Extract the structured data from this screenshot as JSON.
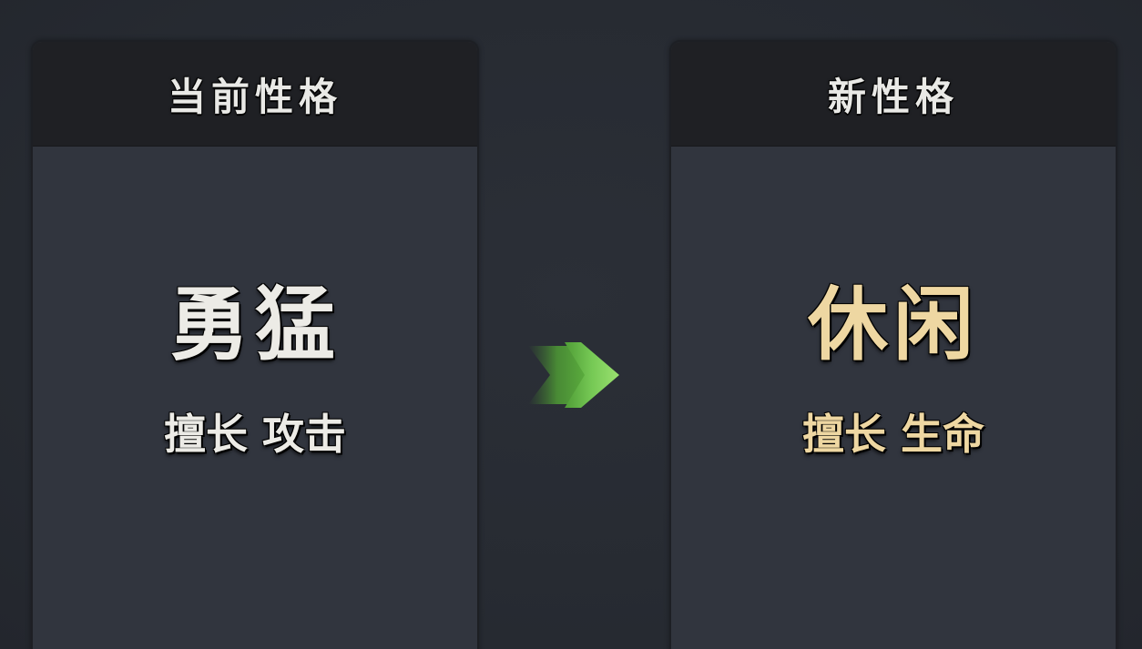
{
  "current_panel": {
    "title": "当前性格",
    "trait_name": "勇猛",
    "trait_desc": "擅长 攻击"
  },
  "new_panel": {
    "title": "新性格",
    "trait_name": "休闲",
    "trait_desc": "擅长 生命"
  },
  "arrow": {
    "icon": "double-arrow-right-icon",
    "color": "#7dd15a"
  },
  "colors": {
    "current_text": "#ecebe6",
    "new_text": "#eed7a2",
    "panel_bg": "#31353e",
    "header_bg": "#1f2024",
    "background": "#272b33"
  }
}
